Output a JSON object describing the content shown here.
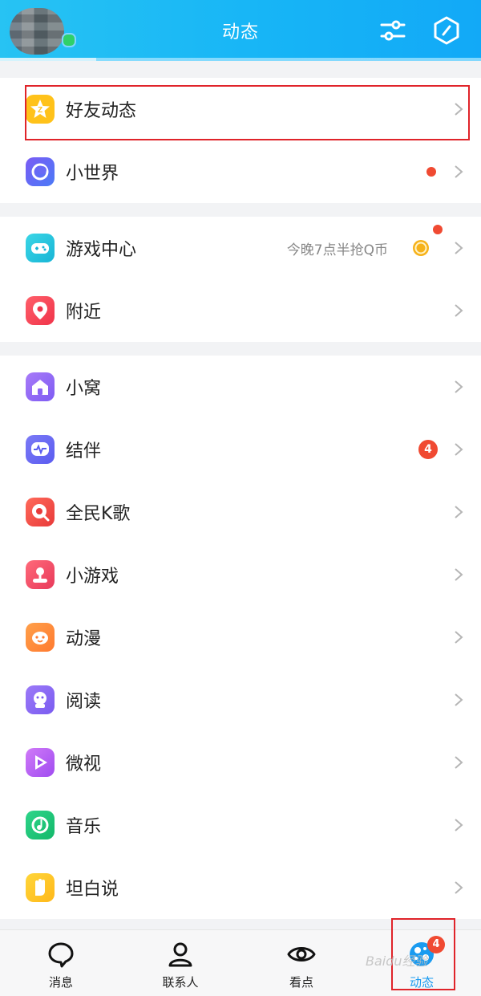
{
  "header": {
    "title": "动态"
  },
  "section1": [
    {
      "label": "好友动态",
      "icon": "star-z-icon",
      "color": "#ffc21a"
    },
    {
      "label": "小世界",
      "icon": "planet-icon",
      "color": "#5b6cf5",
      "red_dot": true
    }
  ],
  "section2": [
    {
      "label": "游戏中心",
      "icon": "gamepad-icon",
      "color": "#1fc6d8",
      "hint": "今晚7点半抢Q币",
      "red_dot": true
    },
    {
      "label": "附近",
      "icon": "location-pin-icon",
      "color": "#f24a5a"
    }
  ],
  "section3": [
    {
      "label": "小窝",
      "icon": "house-icon",
      "color": "#9b6af6"
    },
    {
      "label": "结伴",
      "icon": "pulse-icon",
      "color": "#6a6af0",
      "badge": "4"
    },
    {
      "label": "全民K歌",
      "icon": "ksong-icon",
      "color": "#f04a4a"
    },
    {
      "label": "小游戏",
      "icon": "joystick-icon",
      "color": "#f0506a"
    },
    {
      "label": "动漫",
      "icon": "cartoon-face-icon",
      "color": "#ff8a3c"
    },
    {
      "label": "阅读",
      "icon": "reader-icon",
      "color": "#8a6af6"
    },
    {
      "label": "微视",
      "icon": "play-icon",
      "color": "#b45cf3"
    },
    {
      "label": "音乐",
      "icon": "music-note-icon",
      "color": "#20c577"
    },
    {
      "label": "坦白说",
      "icon": "hand-icon",
      "color": "#ffc51c"
    }
  ],
  "bottom_nav": [
    {
      "label": "消息",
      "icon": "chat-bubble-icon"
    },
    {
      "label": "联系人",
      "icon": "person-icon"
    },
    {
      "label": "看点",
      "icon": "eye-icon"
    },
    {
      "label": "动态",
      "icon": "planet-active-icon",
      "badge": "4",
      "active": true
    }
  ],
  "watermark": "Baidu经验"
}
